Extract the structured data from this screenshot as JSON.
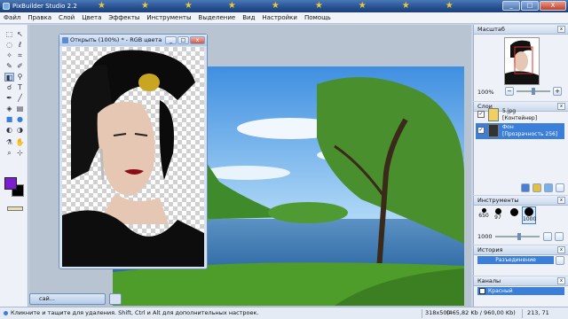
{
  "window": {
    "title": "PixBuilder Studio 2.2",
    "minimize": "_",
    "maximize": "□",
    "close": "X"
  },
  "menu": [
    "Файл",
    "Правка",
    "Слой",
    "Цвета",
    "Эффекты",
    "Инструменты",
    "Выделение",
    "Вид",
    "Настройки",
    "Помощь"
  ],
  "document": {
    "title": "Открыть (100%) * - RGB цвета",
    "min_label": "сай..."
  },
  "scale_panel": {
    "title": "Масштаб",
    "zoom": "100%",
    "zoom_fraction": 0.5
  },
  "layers_panel": {
    "title": "Слои",
    "layers": [
      {
        "name": "5.jpg",
        "type": "[Контейнер]",
        "selected": false
      },
      {
        "name": "Фон",
        "type": "[Прозрачность 256]",
        "selected": true
      }
    ]
  },
  "tools_panel": {
    "title": "Инструменты",
    "brushes": [
      "650",
      "97",
      "",
      "1000"
    ],
    "size_value": "1000",
    "size_fraction": 0.55
  },
  "history_panel": {
    "title": "История",
    "items": [
      "Разъединение"
    ]
  },
  "channels_panel": {
    "title": "Каналы",
    "items": [
      "Красный"
    ]
  },
  "status": {
    "hint": "Кликните и тащите для удаления. Shift, Ctrl и Alt для дополнительных настроек.",
    "size": "318x500",
    "memory": "(465,82 Kb / 960,00 Kb)",
    "coords": "213, 71"
  },
  "colors": {
    "foreground": "#7a1fd0",
    "background": "#000000",
    "accent": "#3b7fd9"
  }
}
